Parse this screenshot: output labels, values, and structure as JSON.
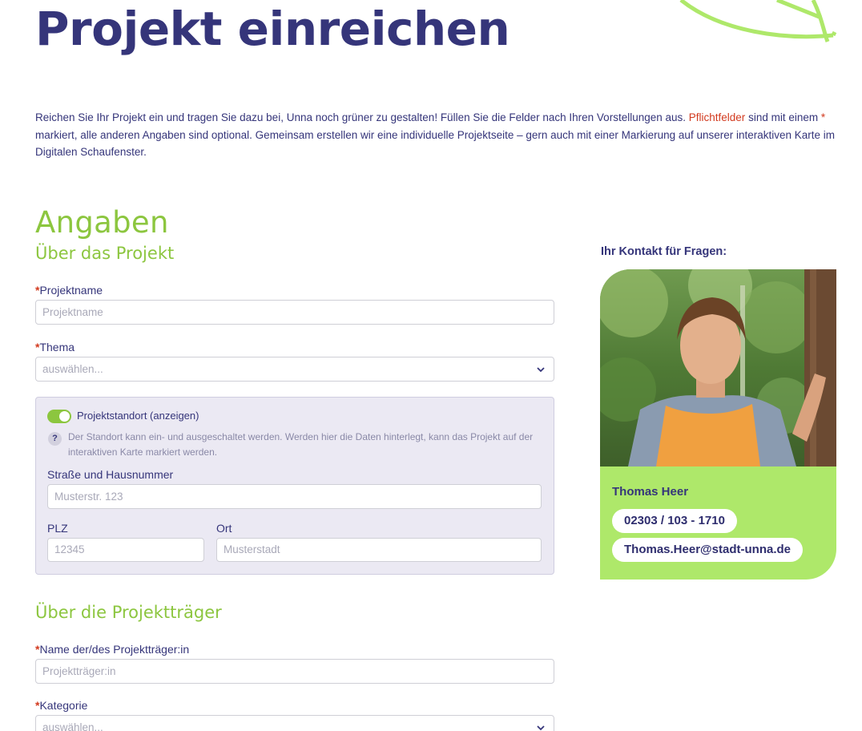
{
  "page": {
    "title": "Projekt einreichen"
  },
  "intro": {
    "part1": "Reichen Sie Ihr Projekt ein und tragen Sie dazu bei, Unna noch grüner zu gestalten! Füllen Sie die Felder nach Ihren Vorstellungen aus. ",
    "required_word": "Pflichtfelder",
    "part2": " sind mit einem ",
    "asterisk": "*",
    "part3": " markiert, alle anderen Angaben sind optional. Gemeinsam erstellen wir eine individuelle Projektseite – gern auch mit einer Markierung auf unserer interaktiven Karte im Digitalen Schaufenster."
  },
  "form": {
    "heading": "Angaben",
    "section_project": "Über das Projekt",
    "required_marker": "*",
    "projektname": {
      "label": "Projektname",
      "placeholder": "Projektname"
    },
    "thema": {
      "label": "Thema",
      "selected": "auswählen..."
    },
    "location": {
      "toggle_label": "Projektstandort (anzeigen)",
      "toggle_on": true,
      "help_icon_text": "?",
      "help_text": "Der Standort kann ein- und ausgeschaltet werden. Werden hier die Daten hinterlegt, kann das Projekt auf der interaktiven Karte markiert werden.",
      "street": {
        "label": "Straße und Hausnummer",
        "placeholder": "Musterstr. 123"
      },
      "plz": {
        "label": "PLZ",
        "placeholder": "12345"
      },
      "ort": {
        "label": "Ort",
        "placeholder": "Musterstadt"
      }
    },
    "section_traeger": "Über die Projektträger",
    "traeger_name": {
      "label": "Name der/des Projektträger:in",
      "placeholder": "Projektträger:in"
    },
    "kategorie": {
      "label": "Kategorie",
      "selected": "auswählen..."
    }
  },
  "contact": {
    "heading": "Ihr Kontakt für Fragen:",
    "name": "Thomas Heer",
    "phone": "02303 / 103 - 1710",
    "email": "Thomas.Heer@stadt-unna.de"
  },
  "colors": {
    "brand_navy": "#35357a",
    "accent_green": "#8cc63f",
    "card_green": "#aee86a",
    "required_red": "#d23a1f"
  }
}
